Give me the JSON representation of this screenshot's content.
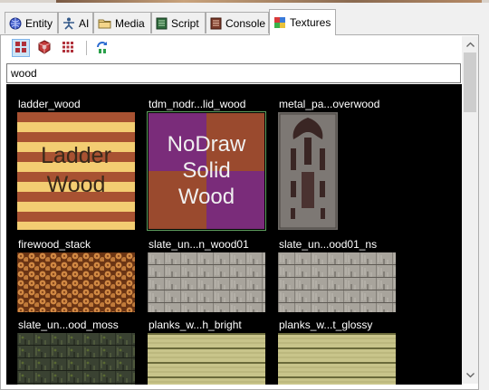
{
  "tabs": [
    {
      "label": "Entity",
      "icon": "entity-globe-icon"
    },
    {
      "label": "AI",
      "icon": "ai-figure-icon"
    },
    {
      "label": "Media",
      "icon": "media-folder-icon"
    },
    {
      "label": "Script",
      "icon": "script-icon"
    },
    {
      "label": "Console",
      "icon": "console-icon"
    },
    {
      "label": "Textures",
      "icon": "textures-icon",
      "active": true
    }
  ],
  "toolbar": {
    "buttons": [
      "view-large-icon",
      "red-cube-icon",
      "view-small-icon",
      "refresh-icon"
    ]
  },
  "search": {
    "value": "wood"
  },
  "textures": [
    {
      "name": "ladder_wood",
      "caption": "Ladder Wood"
    },
    {
      "name": "tdm_nodr...lid_wood",
      "caption": "NoDraw Solid Wood",
      "selected": true
    },
    {
      "name": "metal_pa...overwood"
    },
    {
      "name": "firewood_stack"
    },
    {
      "name": "slate_un...n_wood01"
    },
    {
      "name": "slate_un...ood01_ns"
    },
    {
      "name": "slate_un...ood_moss"
    },
    {
      "name": "planks_w...h_bright"
    },
    {
      "name": "planks_w...t_glossy"
    }
  ],
  "colors": {
    "accent": "#cce4f7",
    "grid_bg": "#000000",
    "selection": "#5fa05f"
  }
}
